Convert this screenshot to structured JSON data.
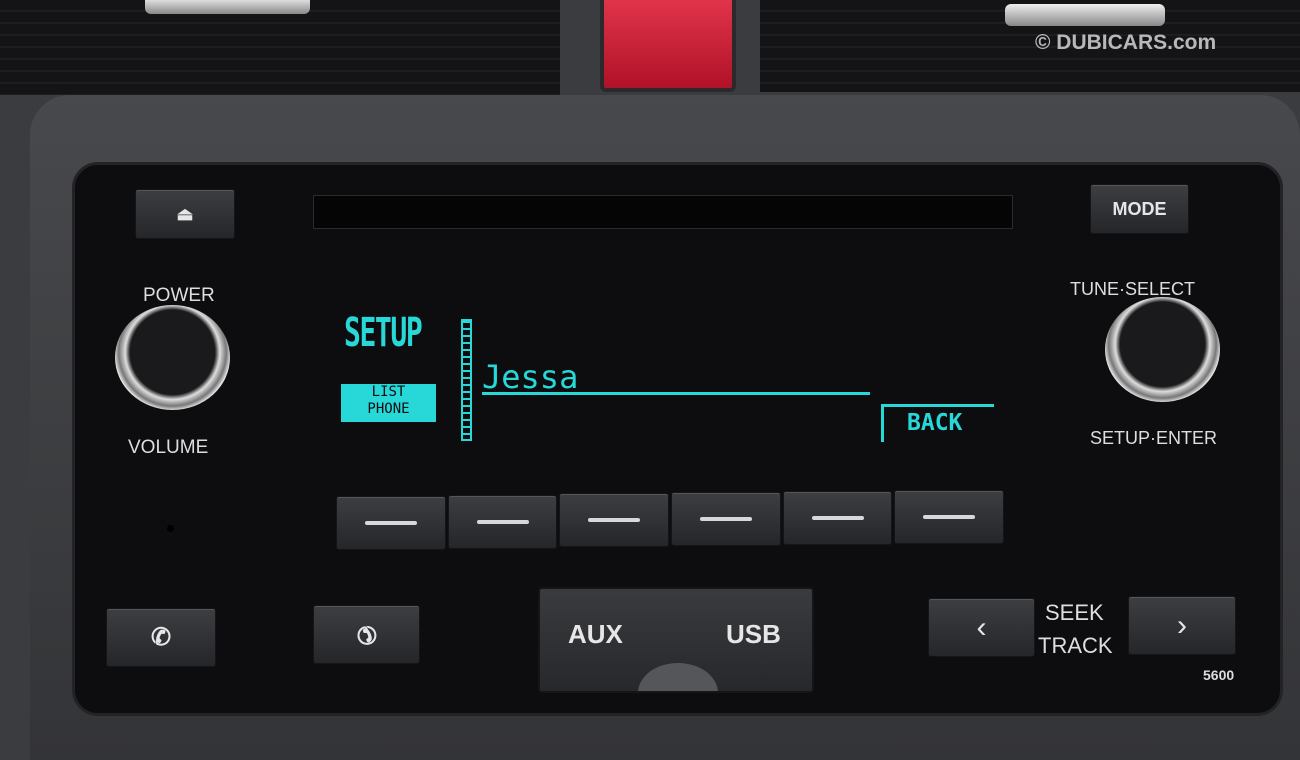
{
  "watermark": "© DUBICARS.com",
  "radio": {
    "labels": {
      "power": "POWER",
      "volume": "VOLUME",
      "tune_select": "TUNE·SELECT",
      "setup_enter": "SETUP·ENTER",
      "seek": "SEEK",
      "track": "TRACK",
      "model": "5600"
    },
    "buttons": {
      "mode": "MODE",
      "aux": "AUX",
      "usb": "USB"
    },
    "icons": {
      "eject": "eject-icon",
      "call": "phone-call-icon",
      "hangup": "phone-hangup-icon",
      "prev": "chevron-left-icon",
      "next": "chevron-right-icon"
    },
    "display": {
      "title": "SETUP",
      "tab_line1": "LIST",
      "tab_line2": "PHONE",
      "entry": "Jessa",
      "back": "BACK",
      "color": "#28d7d7"
    },
    "presets_count": 6
  }
}
